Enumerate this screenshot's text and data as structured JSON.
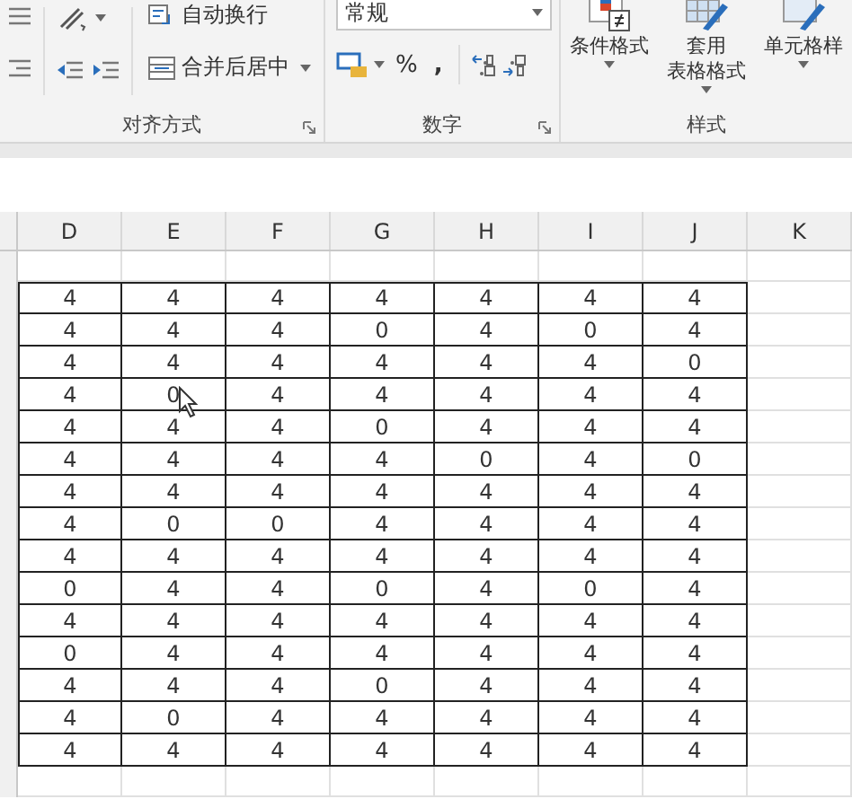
{
  "ribbon": {
    "groups": [
      {
        "kind": "alignment",
        "label": "对齐方式",
        "wrap_button": "自动换行",
        "merge_button": "合并后居中"
      },
      {
        "kind": "number",
        "label": "数字",
        "format_value": "常规",
        "percent": "%",
        "comma": ","
      },
      {
        "kind": "styles",
        "label": "样式",
        "buttons": [
          {
            "lines": [
              "条件格式"
            ]
          },
          {
            "lines": [
              "套用",
              "表格格式"
            ]
          },
          {
            "lines": [
              "单元格样"
            ]
          }
        ]
      }
    ]
  },
  "sheet": {
    "columns": [
      "D",
      "E",
      "F",
      "G",
      "H",
      "I",
      "J",
      "K"
    ],
    "rows": [
      [
        "4",
        "4",
        "4",
        "4",
        "4",
        "4",
        "4"
      ],
      [
        "4",
        "4",
        "4",
        "0",
        "4",
        "0",
        "4"
      ],
      [
        "4",
        "4",
        "4",
        "4",
        "4",
        "4",
        "0"
      ],
      [
        "4",
        "0",
        "4",
        "4",
        "4",
        "4",
        "4"
      ],
      [
        "4",
        "4",
        "4",
        "0",
        "4",
        "4",
        "4"
      ],
      [
        "4",
        "4",
        "4",
        "4",
        "0",
        "4",
        "0"
      ],
      [
        "4",
        "4",
        "4",
        "4",
        "4",
        "4",
        "4"
      ],
      [
        "4",
        "0",
        "0",
        "4",
        "4",
        "4",
        "4"
      ],
      [
        "4",
        "4",
        "4",
        "4",
        "4",
        "4",
        "4"
      ],
      [
        "0",
        "4",
        "4",
        "0",
        "4",
        "0",
        "4"
      ],
      [
        "4",
        "4",
        "4",
        "4",
        "4",
        "4",
        "4"
      ],
      [
        "0",
        "4",
        "4",
        "4",
        "4",
        "4",
        "4"
      ],
      [
        "4",
        "4",
        "4",
        "0",
        "4",
        "4",
        "4"
      ],
      [
        "4",
        "0",
        "4",
        "4",
        "4",
        "4",
        "4"
      ],
      [
        "4",
        "4",
        "4",
        "4",
        "4",
        "4",
        "4"
      ]
    ]
  }
}
